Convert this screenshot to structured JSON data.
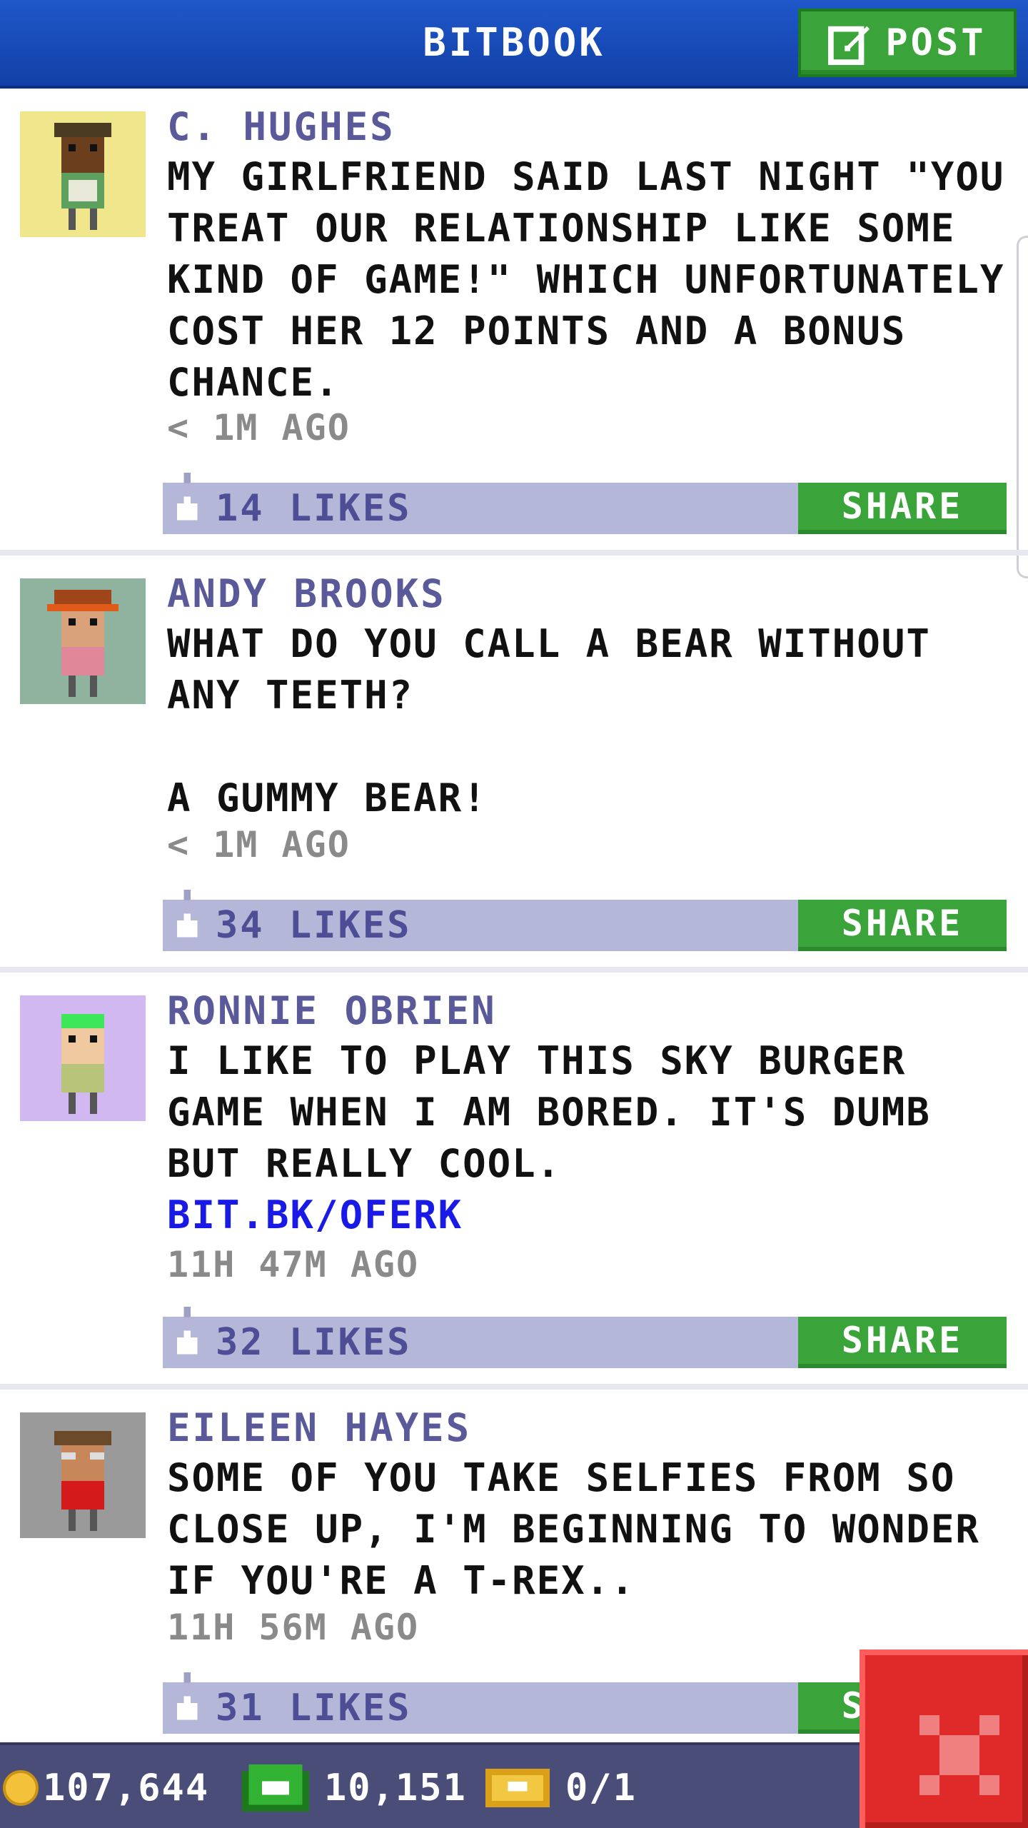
{
  "header": {
    "title": "BITBOOK",
    "post_label": "POST"
  },
  "posts": [
    {
      "author": "C. HUGHES",
      "text": "MY GIRLFRIEND SAID LAST NIGHT \"YOU TREAT OUR RELATIONSHIP LIKE SOME KIND OF GAME!\" WHICH UNFORTUNATELY COST HER 12 POINTS AND A BONUS CHANCE.",
      "link": "",
      "time": "< 1M AGO",
      "likes": "14 LIKES",
      "share": "SHARE",
      "avatar_bg": "#f0e68c"
    },
    {
      "author": "ANDY BROOKS",
      "text": "WHAT DO YOU CALL A BEAR WITHOUT ANY TEETH?\n\nA GUMMY BEAR!",
      "link": "",
      "time": "< 1M AGO",
      "likes": "34 LIKES",
      "share": "SHARE",
      "avatar_bg": "#8fb39f"
    },
    {
      "author": "RONNIE OBRIEN",
      "text": "I LIKE TO PLAY THIS SKY BURGER GAME WHEN I AM BORED. IT'S DUMB BUT REALLY COOL.",
      "link": "BIT.BK/OFERK",
      "time": "11H 47M AGO",
      "likes": "32 LIKES",
      "share": "SHARE",
      "avatar_bg": "#d2b8f0"
    },
    {
      "author": "EILEEN HAYES",
      "text": "SOME OF YOU TAKE SELFIES FROM SO CLOSE UP, I'M BEGINNING TO WONDER IF YOU'RE A T-REX..",
      "link": "",
      "time": "11H 56M AGO",
      "likes": "31 LIKES",
      "share": "SHARE",
      "avatar_bg": "#9a9a9a"
    }
  ],
  "footer": {
    "coins": "107,644",
    "bux": "10,151",
    "tickets": "0/1"
  },
  "colors": {
    "header": "#1f57c9",
    "share_green": "#3aa33a",
    "like_bar": "#b5b7d9",
    "close_red": "#e02a2a",
    "link_blue": "#1a1ae6"
  }
}
